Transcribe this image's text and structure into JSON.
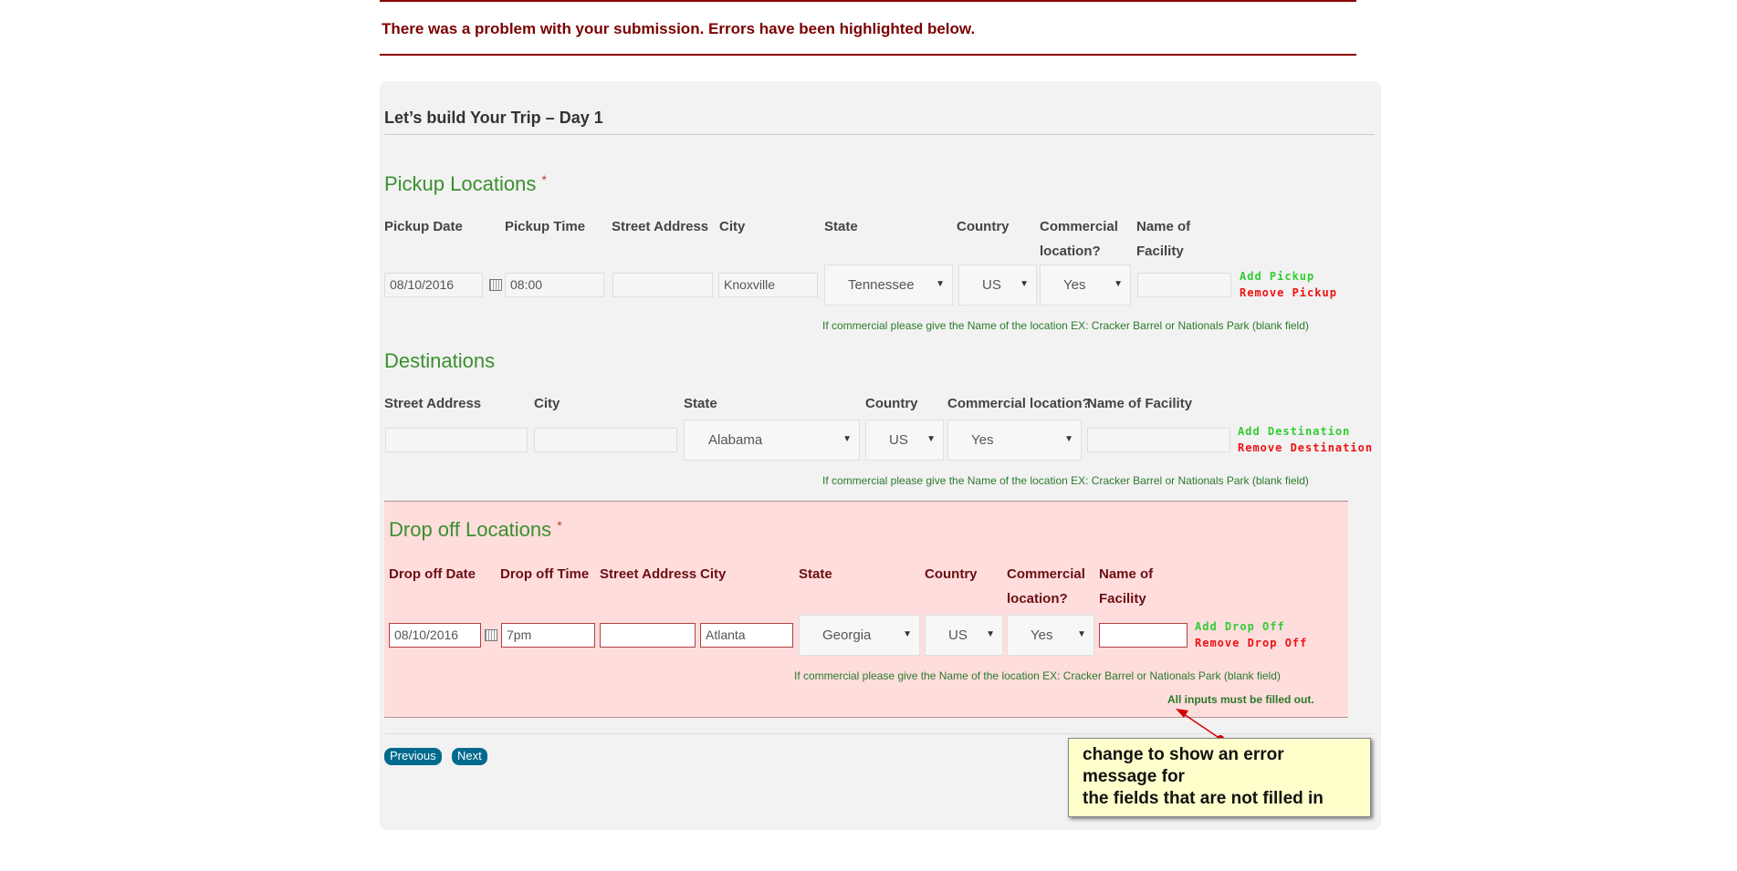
{
  "error_banner": "There was a problem with your submission. Errors have been highlighted below.",
  "form_title": "Let’s build Your Trip – Day 1",
  "pickup": {
    "heading": "Pickup Locations",
    "required_mark": "*",
    "labels": {
      "date": "Pickup Date",
      "time": "Pickup Time",
      "street": "Street Address",
      "city": "City",
      "state": "State",
      "country": "Country",
      "commercial_1": "Commercial",
      "commercial_2": "location?",
      "facility_1": "Name of",
      "facility_2": "Facility"
    },
    "values": {
      "date": "08/10/2016",
      "time": "08:00",
      "street": "",
      "city": "Knoxville",
      "state": "Tennessee",
      "country": "US",
      "commercial": "Yes",
      "facility": ""
    },
    "add_label": "Add Pickup",
    "remove_label": "Remove Pickup",
    "hint": "If commercial please give the Name of the location EX: Cracker Barrel or Nationals Park (blank field)"
  },
  "destinations": {
    "heading": "Destinations",
    "labels": {
      "street": "Street Address",
      "city": "City",
      "state": "State",
      "country": "Country",
      "commercial": "Commercial location?",
      "facility": "Name of Facility"
    },
    "values": {
      "street": "",
      "city": "",
      "state": "Alabama",
      "country": "US",
      "commercial": "Yes",
      "facility": ""
    },
    "add_label": "Add Destination",
    "remove_label": "Remove Destination",
    "hint": "If commercial please give the Name of the location EX: Cracker Barrel or Nationals Park (blank field)"
  },
  "dropoff": {
    "heading": "Drop off Locations",
    "required_mark": "*",
    "labels": {
      "date": "Drop off Date",
      "time": "Drop off Time",
      "street": "Street Address",
      "city": "City",
      "state": "State",
      "country": "Country",
      "commercial_1": "Commercial",
      "commercial_2": "location?",
      "facility_1": "Name of",
      "facility_2": "Facility"
    },
    "values": {
      "date": "08/10/2016",
      "time": "7pm",
      "street": "",
      "city": "Atlanta",
      "state": "Georgia",
      "country": "US",
      "commercial": "Yes",
      "facility": ""
    },
    "add_label": "Add Drop Off",
    "remove_label": "Remove Drop Off",
    "hint": "If commercial please give the Name of the location EX: Cracker Barrel or Nationals Park (blank field)",
    "error": "All inputs must be filled out."
  },
  "buttons": {
    "previous": "Previous",
    "next": "Next"
  },
  "annotation": {
    "line1": "change to show an error",
    "line2": "message for",
    "line3": "the fields that are not filled in"
  },
  "colors": {
    "error_red": "#7a0000",
    "section_green": "#3a8f2e",
    "error_bg": "#ffdddd",
    "button_blue": "#006a8e",
    "note_bg": "#ffffcc"
  },
  "icons": [
    "calendar-icon",
    "chevron-down-icon",
    "arrow-pointer"
  ]
}
